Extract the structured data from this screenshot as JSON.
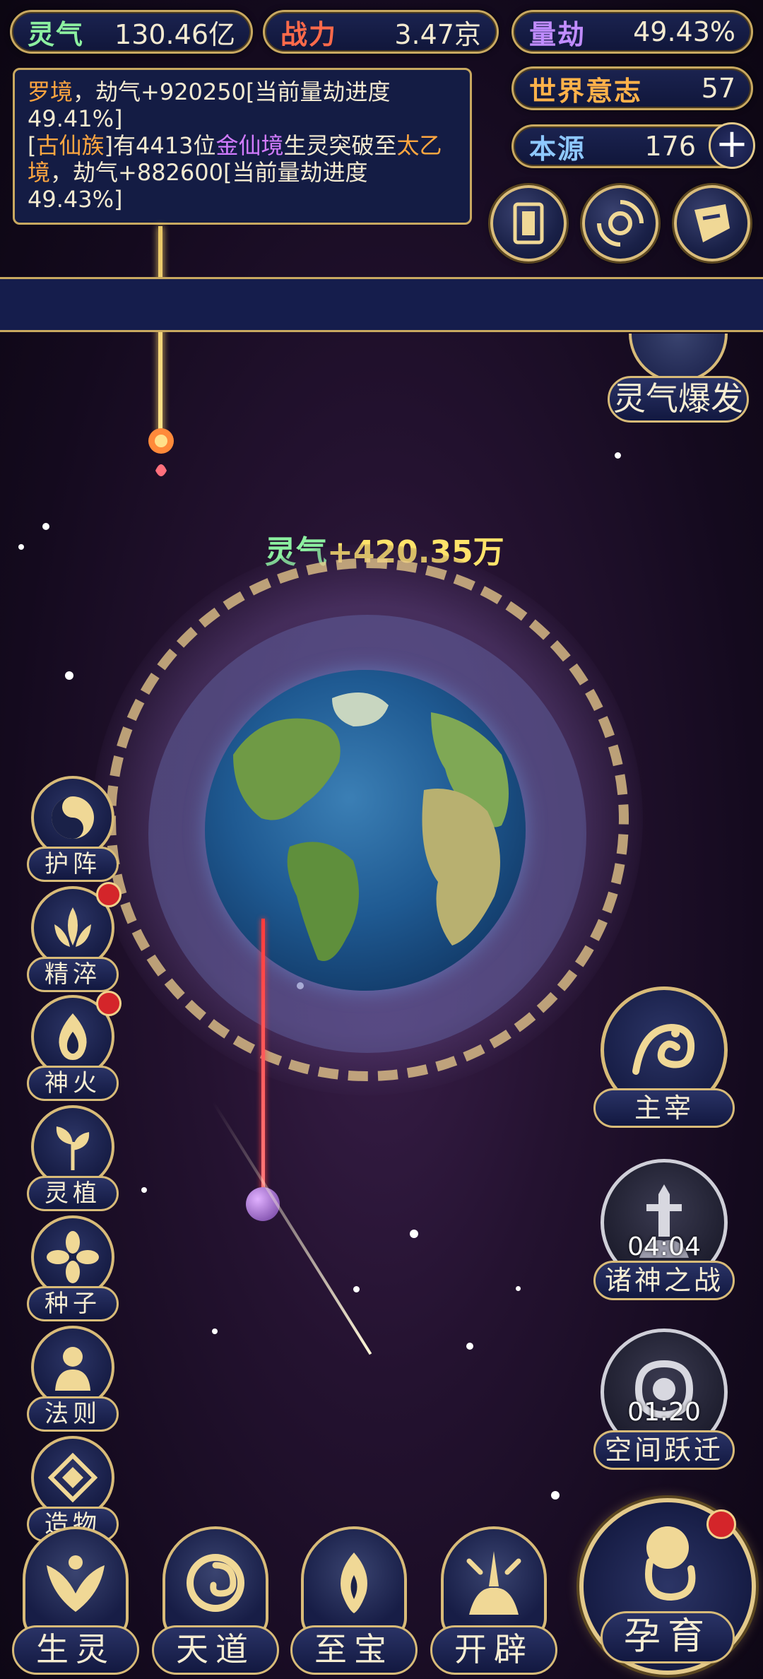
{
  "stats": {
    "lingqi": {
      "label": "灵气",
      "value": "130.46亿",
      "color": "#8cf0a0"
    },
    "zhanli": {
      "label": "战力",
      "value": "3.47京",
      "color": "#ff6a4a"
    },
    "liangjie": {
      "label": "量劫",
      "value": "49.43%",
      "color": "#c08cff"
    },
    "shijie": {
      "label": "世界意志",
      "value": "57",
      "color": "#ffb24a"
    },
    "benyuan": {
      "label": "本源",
      "value": "176",
      "color": "#8ec8ff",
      "plus": "+"
    }
  },
  "log": {
    "line1_a": "罗境",
    "line1_b": "，劫气+920250[当前量劫进度49.41%]",
    "line2_a": "[",
    "line2_b": "古仙族",
    "line2_c": "]有4413位",
    "line2_d": "金仙境",
    "line2_e": "生灵突破至",
    "line2_f": "太乙境",
    "line2_g": "，劫气+882600[当前量劫进度49.43%]"
  },
  "top_icons": [
    "card-icon",
    "vortex-icon",
    "scroll-icon"
  ],
  "burst_label": "灵气爆发",
  "gain": {
    "label": "灵气",
    "value": "+420.35万"
  },
  "left_features": [
    {
      "label": "护阵",
      "icon": "yin-yang-icon",
      "badge": false
    },
    {
      "label": "精淬",
      "icon": "lotus-flame-icon",
      "badge": true
    },
    {
      "label": "神火",
      "icon": "fire-icon",
      "badge": true
    },
    {
      "label": "灵植",
      "icon": "plant-icon",
      "badge": false
    },
    {
      "label": "种子",
      "icon": "flower-icon",
      "badge": false
    },
    {
      "label": "法则",
      "icon": "statue-icon",
      "badge": false
    },
    {
      "label": "造物",
      "icon": "diamond-icon",
      "badge": false
    }
  ],
  "right_features": {
    "master": {
      "label": "主宰",
      "icon": "dragon-icon"
    },
    "gods_war": {
      "label": "诸神之战",
      "timer": "04:04",
      "icon": "sword-icon"
    },
    "space_jump": {
      "label": "空间跃迁",
      "timer": "01:20",
      "icon": "swirl-icon"
    }
  },
  "bottom_nav": [
    {
      "label": "生灵",
      "icon": "phoenix-icon"
    },
    {
      "label": "天道",
      "icon": "cloud-swirl-icon"
    },
    {
      "label": "至宝",
      "icon": "treasure-icon"
    },
    {
      "label": "开辟",
      "icon": "axe-icon"
    }
  ],
  "nurture": {
    "label": "孕育",
    "icon": "embryo-icon",
    "badge": true
  }
}
